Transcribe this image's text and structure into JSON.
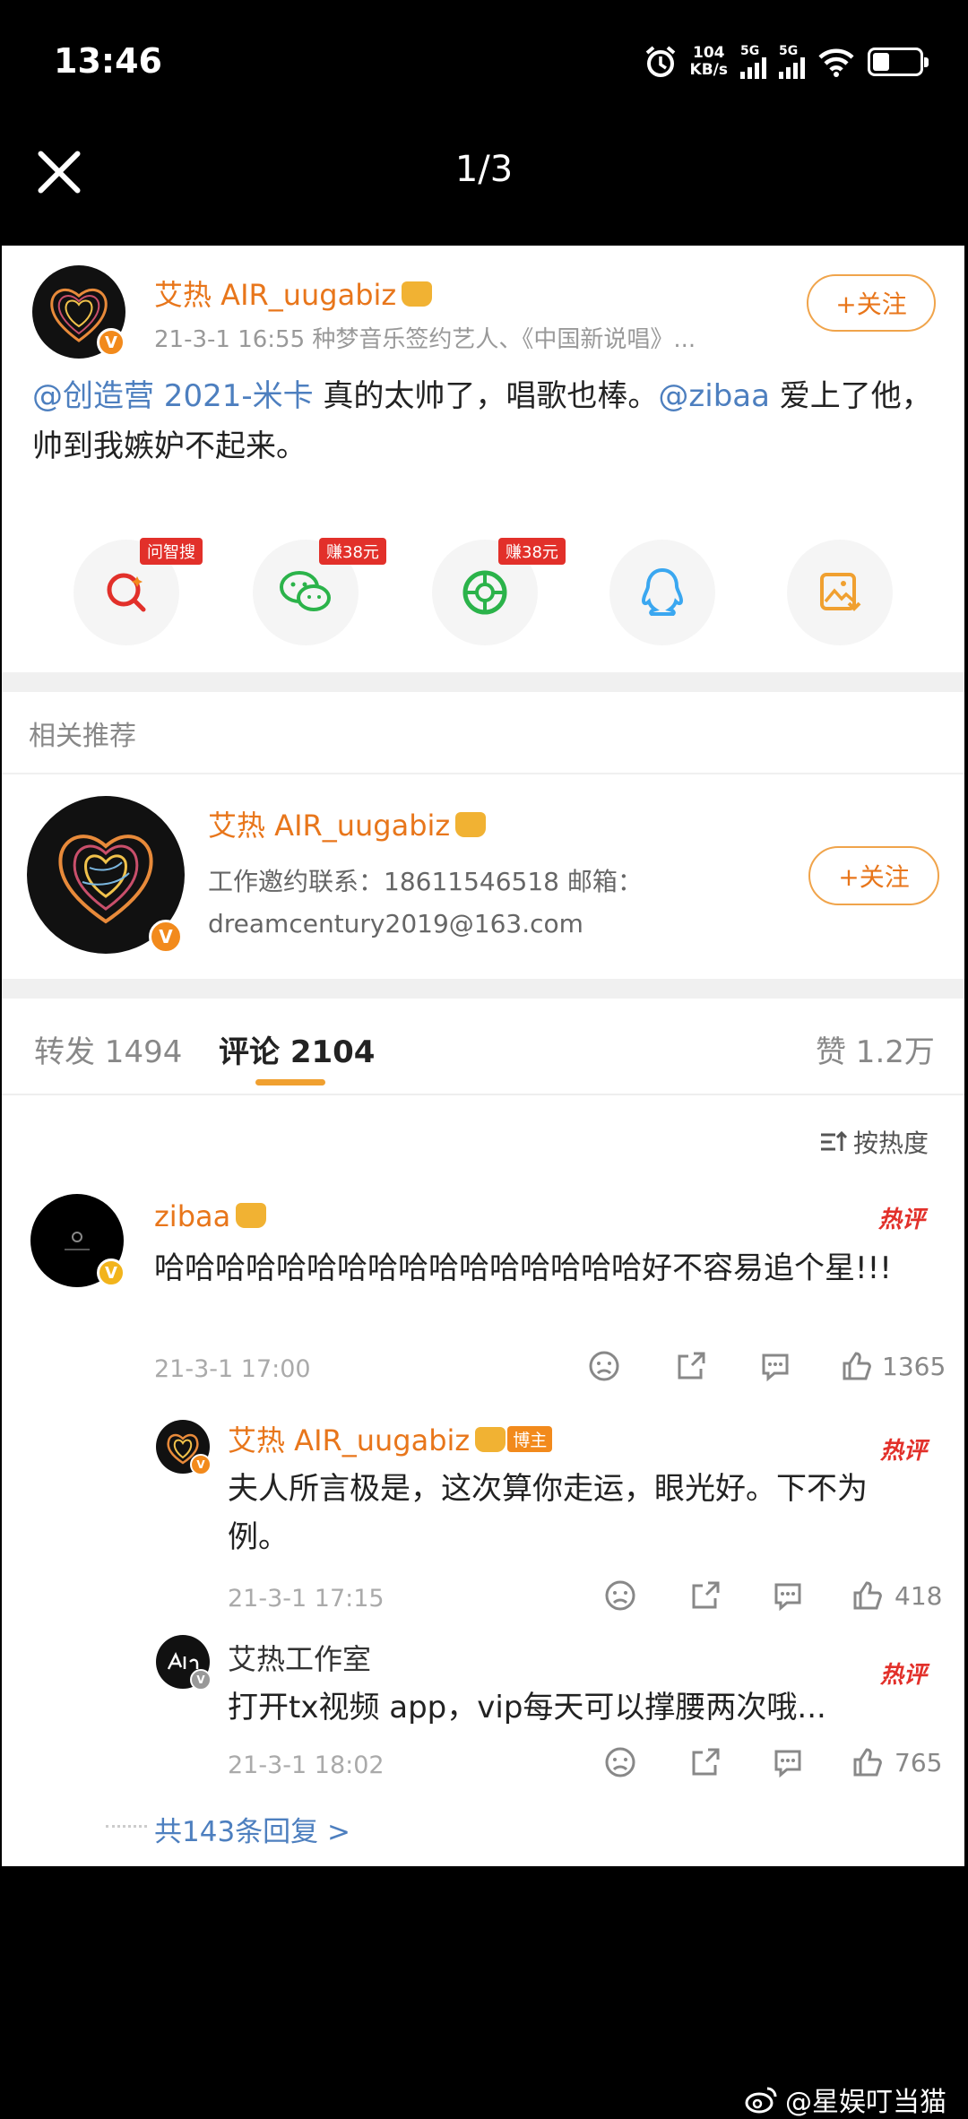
{
  "status": {
    "time": "13:46",
    "speed": "104",
    "speed_unit": "KB/s",
    "sim1": "5G",
    "sim2": "5G"
  },
  "viewer": {
    "counter": "1/3"
  },
  "post": {
    "author": "艾热 AIR_uugabiz",
    "meta": "21-3-1 16:55  种梦音乐签约艺人、《中国新说唱》...",
    "follow": "+关注",
    "text_mention1": "@创造营 2021-米卡",
    "text_part1": " 真的太帅了，唱歌也棒。",
    "text_mention2": "@zibaa",
    "text_part2": " 爱上了他，帅到我嫉妒不起来。"
  },
  "share": [
    {
      "tag": "问智搜",
      "icon": "search-ai-icon"
    },
    {
      "tag": "赚38元",
      "icon": "wechat-icon"
    },
    {
      "tag": "赚38元",
      "icon": "moments-icon"
    },
    {
      "tag": "",
      "icon": "qq-icon"
    },
    {
      "tag": "",
      "icon": "save-image-icon"
    }
  ],
  "related": {
    "title": "相关推荐",
    "name": "艾热 AIR_uugabiz",
    "line1": "工作邀约联系：18611546518  邮箱：",
    "line2": "dreamcentury2019@163.com",
    "follow": "+关注"
  },
  "tabs": {
    "repost": "转发 1494",
    "comments": "评论 2104",
    "likes": "赞 1.2万"
  },
  "sort": "按热度",
  "comments": {
    "main": {
      "name": "zibaa",
      "text": "哈哈哈哈哈哈哈哈哈哈哈哈哈哈哈哈好不容易追个星!!!",
      "date": "21-3-1 17:00",
      "likes": "1365",
      "hot": "热评"
    },
    "reply1": {
      "name": "艾热 AIR_uugabiz",
      "owner_tag": "博主",
      "text": "夫人所言极是，这次算你走运，眼光好。下不为例。",
      "date": "21-3-1 17:15",
      "likes": "418",
      "hot": "热评"
    },
    "reply2": {
      "name": "艾热工作室",
      "text": "打开tx视频 app，vip每天可以撑腰两次哦...",
      "date": "21-3-1 18:02",
      "likes": "765",
      "hot": "热评"
    },
    "more": "共143条回复 >"
  },
  "watermark": "@星娱叮当猫",
  "colors": {
    "accent": "#e8761b",
    "link": "#4d7fbf",
    "hot": "#e2302a",
    "tab_underline": "#f0a030"
  }
}
